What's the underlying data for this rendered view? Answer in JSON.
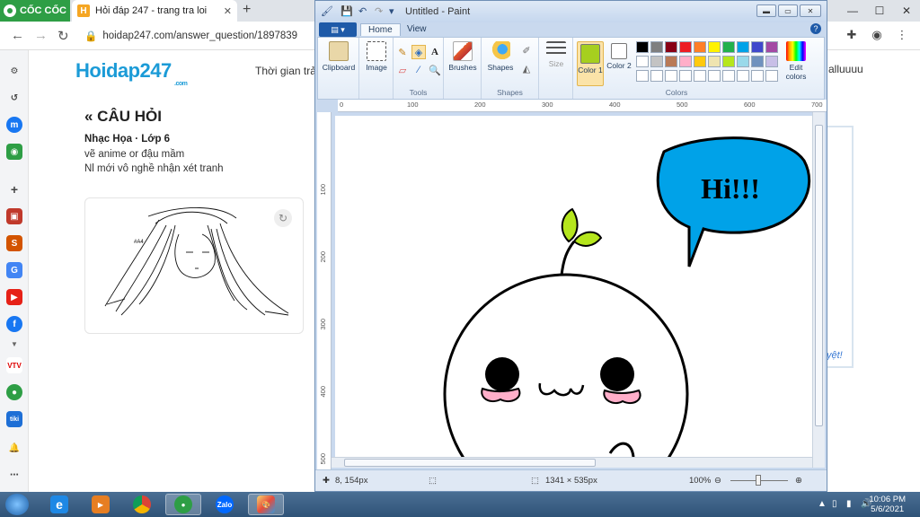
{
  "browser": {
    "brand": "CỐC CỐC",
    "tab_title": "Hỏi đáp 247 - trang tra loi",
    "tab_favicon": "H",
    "url": "hoidap247.com/answer_question/1897839"
  },
  "page": {
    "logo_main": "Hoidap247",
    "logo_sub": ".com",
    "nav_time": "Thời gian trả",
    "nav_right": "alluuuu",
    "question_title": "« CÂU HỎI",
    "meta": "Nhạc Họa · Lớp 6",
    "line1": "vẽ anime or đậu mầm",
    "line2": "Nl mới vô nghề  nhận xét tranh",
    "sketch_label": "#A4",
    "link_fragment": "yệt!"
  },
  "paint": {
    "title": "Untitled - Paint",
    "menu_tabs": [
      "Home",
      "View"
    ],
    "groups": {
      "clipboard": "Clipboard",
      "image": "Image",
      "tools": "Tools",
      "brushes": "Brushes",
      "shapes": "Shapes",
      "shapes_group": "Shapes",
      "size": "Size",
      "color1": "Color 1",
      "color2": "Color 2",
      "colors": "Colors",
      "edit_colors": "Edit colors"
    },
    "color1_value": "#a6cf1f",
    "color2_value": "#ffffff",
    "palette": [
      [
        "#000000",
        "#7f7f7f",
        "#880015",
        "#ed1c24",
        "#ff7f27",
        "#fff200",
        "#22b14c",
        "#00a2e8",
        "#3f48cc",
        "#a349a4"
      ],
      [
        "#ffffff",
        "#c3c3c3",
        "#b97a57",
        "#ffaec9",
        "#ffc90e",
        "#efe4b0",
        "#b5e61d",
        "#99d9ea",
        "#7092be",
        "#c8bfe7"
      ],
      [
        "#ffffff",
        "#ffffff",
        "#ffffff",
        "#ffffff",
        "#ffffff",
        "#ffffff",
        "#ffffff",
        "#ffffff",
        "#ffffff",
        "#ffffff"
      ]
    ],
    "ruler_h": [
      "0",
      "100",
      "200",
      "300",
      "400",
      "500",
      "600",
      "700"
    ],
    "ruler_v": [
      "100",
      "200",
      "300",
      "400",
      "500"
    ],
    "speech_text": "Hi!!!",
    "status_pos": "8, 154px",
    "status_size": "1341 × 535px",
    "zoom": "100%"
  },
  "taskbar": {
    "time": "10:06 PM",
    "date": "5/6/2021",
    "apps": [
      "ie-icon",
      "media-player-icon",
      "chrome-icon",
      "coccoc-icon",
      "zalo-icon",
      "paint-icon"
    ]
  }
}
